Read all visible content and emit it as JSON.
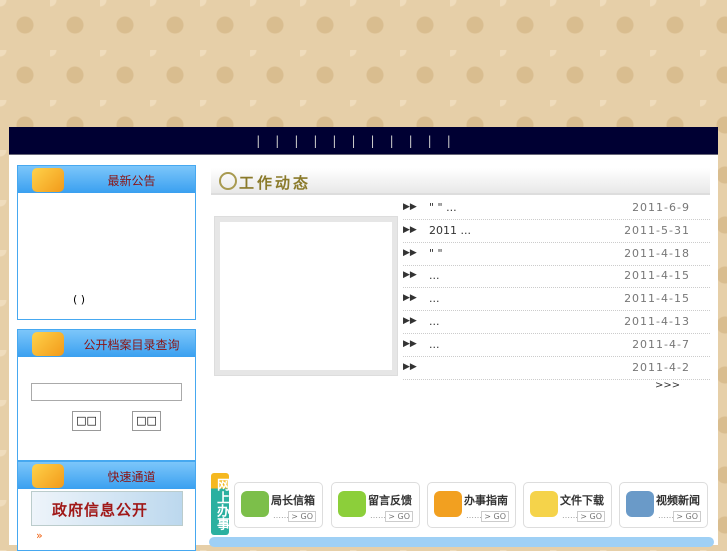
{
  "nav": {
    "separators": [
      "|",
      "|",
      "|",
      "|",
      "|",
      "|",
      "|",
      "|",
      "|",
      "|",
      "|"
    ]
  },
  "notice": {
    "title": "最新公告",
    "text": "(   )"
  },
  "archive": {
    "title": "公开档案目录查询",
    "search_value": "",
    "btn1": "□□",
    "btn2": "□□"
  },
  "quick": {
    "title": "快速通道",
    "banner": "政府信息公开",
    "arrow": "»"
  },
  "work": {
    "title": "工作动态",
    "more": ">>>",
    "items": [
      {
        "title": "\"    \"  ...",
        "date": "2011-6-9"
      },
      {
        "title": "   2011     ...",
        "date": "2011-5-31"
      },
      {
        "title": "\"    \"",
        "date": "2011-4-18"
      },
      {
        "title": "          ...",
        "date": "2011-4-15"
      },
      {
        "title": "          ...",
        "date": "2011-4-15"
      },
      {
        "title": "          ...",
        "date": "2011-4-13"
      },
      {
        "title": "          ...",
        "date": "2011-4-7"
      },
      {
        "title": "",
        "date": "2011-4-2"
      }
    ]
  },
  "online": {
    "label": "网上办事",
    "dots": "……",
    "go": "> GO",
    "cards": [
      {
        "label": "局长信箱",
        "color": "#7cbf4a"
      },
      {
        "label": "留言反馈",
        "color": "#8ccf3a"
      },
      {
        "label": "办事指南",
        "color": "#f2a020"
      },
      {
        "label": "文件下载",
        "color": "#f5d34a"
      },
      {
        "label": "视频新闻",
        "color": "#6a9ac8"
      }
    ]
  }
}
